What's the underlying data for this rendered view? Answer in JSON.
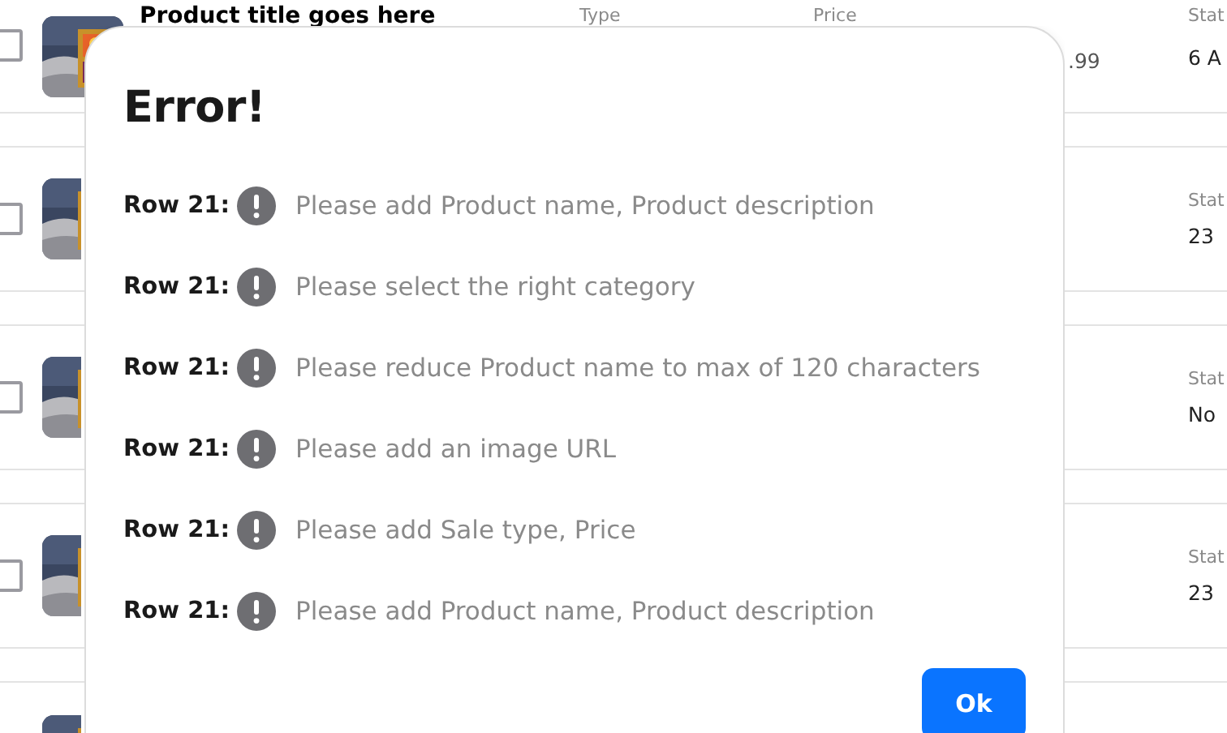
{
  "products": [
    {
      "checked": false,
      "title": "Product title goes here",
      "type_label": "Type",
      "price_label": "Price",
      "price": ".99",
      "status_label": "Stat",
      "status": "6 A"
    },
    {
      "checked": false,
      "status_label": "Stat",
      "status": "23"
    },
    {
      "checked": false,
      "status_label": "Stat",
      "status": "No"
    },
    {
      "checked": false,
      "status_label": "Stat",
      "status": "23"
    },
    {
      "kind": "picture"
    }
  ],
  "dialog": {
    "title": "Error!",
    "errors": [
      {
        "row": "Row 21:",
        "message": "Please add Product name, Product description"
      },
      {
        "row": "Row 21:",
        "message": "Please select the right category"
      },
      {
        "row": "Row 21:",
        "message": "Please reduce Product name to max of 120 characters"
      },
      {
        "row": "Row 21:",
        "message": "Please add an image URL"
      },
      {
        "row": "Row 21:",
        "message": "Please add Sale type, Price"
      },
      {
        "row": "Row 21:",
        "message": "Please add Product name, Product description"
      }
    ],
    "button": "Ok"
  }
}
